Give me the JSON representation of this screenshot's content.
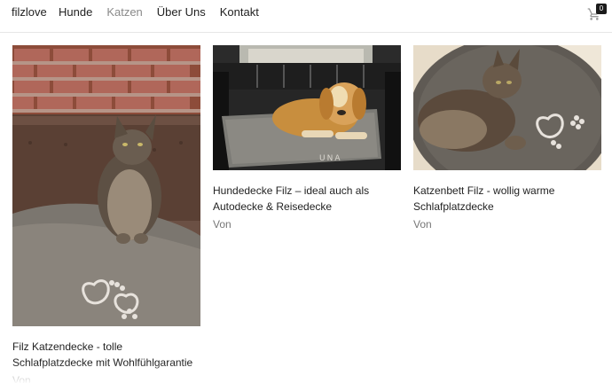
{
  "header": {
    "brand": "filzlove",
    "nav": [
      {
        "label": "Hunde",
        "active": false
      },
      {
        "label": "Katzen",
        "active": true
      },
      {
        "label": "Über Uns",
        "active": false
      },
      {
        "label": "Kontakt",
        "active": false
      }
    ],
    "cart": {
      "icon": "cart-icon",
      "count": "0"
    }
  },
  "products": [
    {
      "title": "Filz Katzendecke - tolle Schlafplatzdecke mit Wohlfühlgarantie",
      "price_label": "Von",
      "image": "cat-on-felt-blanket"
    },
    {
      "title": "Hundedecke Filz – ideal auch als Autodecke & Reisedecke",
      "price_label": "Von",
      "image": "dog-on-felt-blanket-in-car"
    },
    {
      "title": "Katzenbett Filz - wollig warme Schlafplatzdecke",
      "price_label": "Von",
      "image": "cat-lying-on-round-felt-bed"
    }
  ],
  "colors": {
    "text": "#222222",
    "nav_active": "#8a8a8a",
    "muted": "#777777",
    "badge": "#1b1b1b"
  }
}
